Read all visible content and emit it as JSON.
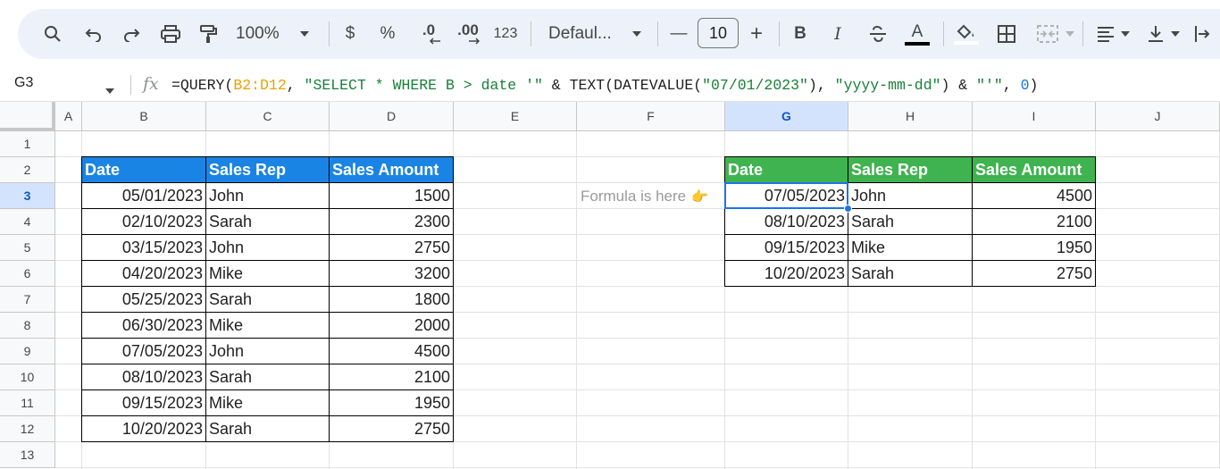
{
  "toolbar": {
    "zoom": "100%",
    "currency": "$",
    "percent": "%",
    "decrease_decimal": ".0",
    "increase_decimal": ".00",
    "number_format": "123",
    "font_name": "Defaul...",
    "font_size": "10",
    "minus": "—",
    "plus": "+",
    "bold": "B",
    "italic": "I",
    "text_color_letter": "A",
    "text_color_bar": "#000000"
  },
  "formula_bar": {
    "name_box": "G3",
    "fx": "fx",
    "formula_parts": {
      "p1": "=QUERY(",
      "p2": "B2:D12",
      "p3": ", ",
      "p4": "\"SELECT * WHERE B > date '\"",
      "p5": " & TEXT(DATEVALUE(",
      "p6": "\"07/01/2023\"",
      "p7": "), ",
      "p8": "\"yyyy-mm-dd\"",
      "p9": ") & ",
      "p10": "\"'\"",
      "p11": ", ",
      "p12": "0",
      "p13": ")"
    }
  },
  "columns": [
    "A",
    "B",
    "C",
    "D",
    "E",
    "F",
    "G",
    "H",
    "I",
    "J"
  ],
  "active_column": "G",
  "rows": [
    "1",
    "2",
    "3",
    "4",
    "5",
    "6",
    "7",
    "8",
    "9",
    "10",
    "11",
    "12",
    "13"
  ],
  "active_row": "3",
  "source_table": {
    "headers": [
      "Date",
      "Sales Rep",
      "Sales Amount"
    ],
    "header_color": "#1a84e4",
    "rows": [
      [
        "05/01/2023",
        "John",
        "1500"
      ],
      [
        "02/10/2023",
        "Sarah",
        "2300"
      ],
      [
        "03/15/2023",
        "John",
        "2750"
      ],
      [
        "04/20/2023",
        "Mike",
        "3200"
      ],
      [
        "05/25/2023",
        "Sarah",
        "1800"
      ],
      [
        "06/30/2023",
        "Mike",
        "2000"
      ],
      [
        "07/05/2023",
        "John",
        "4500"
      ],
      [
        "08/10/2023",
        "Sarah",
        "2100"
      ],
      [
        "09/15/2023",
        "Mike",
        "1950"
      ],
      [
        "10/20/2023",
        "Sarah",
        "2750"
      ]
    ]
  },
  "note": {
    "text": "Formula is here",
    "emoji": "👉"
  },
  "result_table": {
    "headers": [
      "Date",
      "Sales Rep",
      "Sales Amount"
    ],
    "header_color": "#3fb34f",
    "rows": [
      [
        "07/05/2023",
        "John",
        "4500"
      ],
      [
        "08/10/2023",
        "Sarah",
        "2100"
      ],
      [
        "09/15/2023",
        "Mike",
        "1950"
      ],
      [
        "10/20/2023",
        "Sarah",
        "2750"
      ]
    ]
  }
}
